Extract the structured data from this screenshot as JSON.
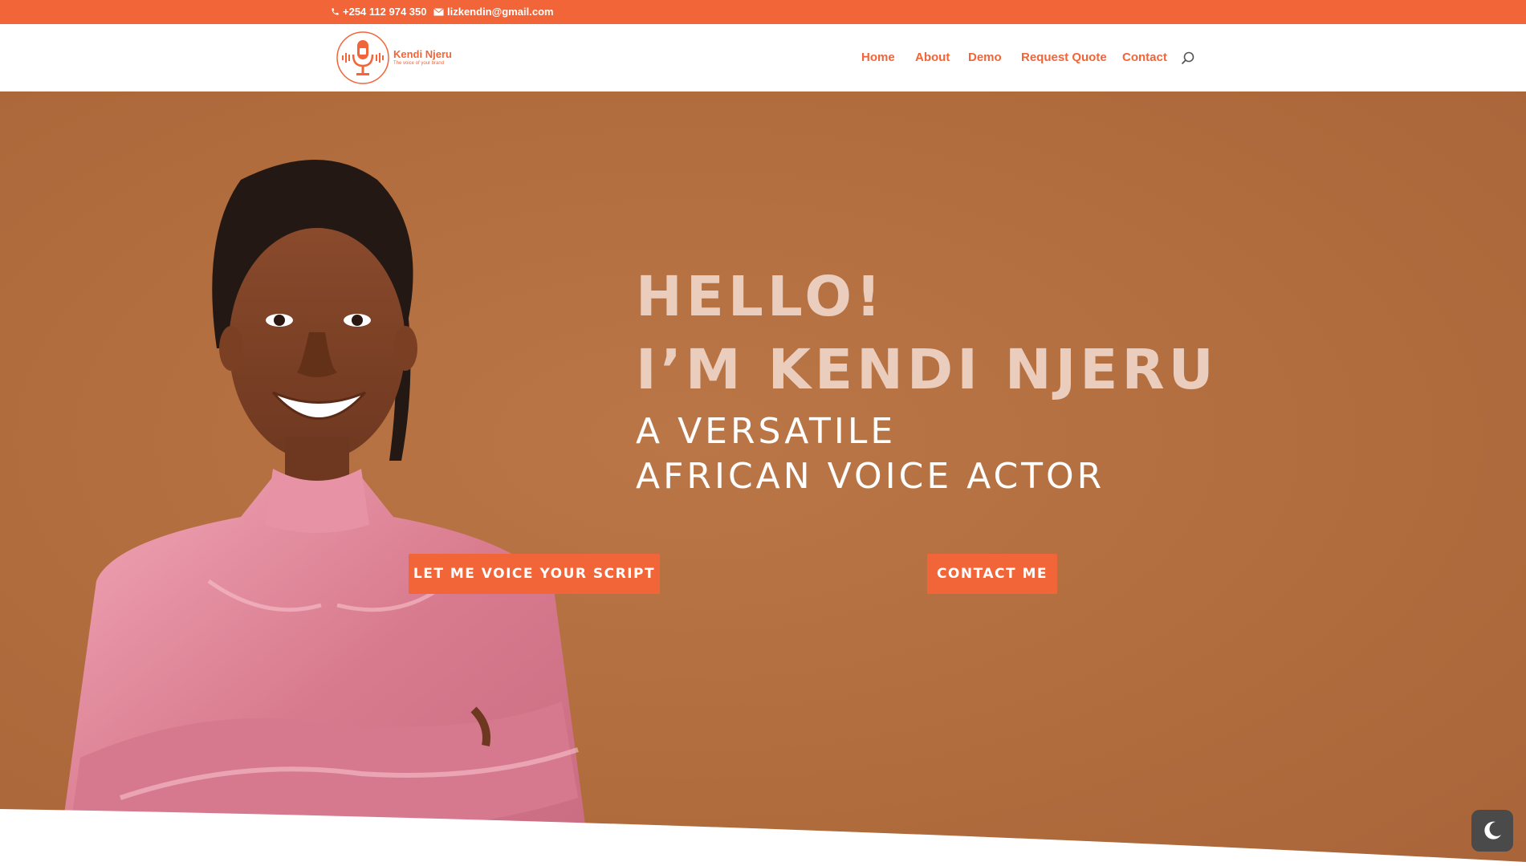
{
  "topbar": {
    "phone": "+254 112 974 350",
    "email": "lizkendin@gmail.com",
    "phone_icon": "phone-icon",
    "email_icon": "envelope-icon",
    "background": "#f26538"
  },
  "header": {
    "logo": {
      "name": "Kendi Njeru",
      "tagline": "The voice of your brand",
      "icon": "microphone-icon"
    },
    "nav": [
      {
        "label": "Home"
      },
      {
        "label": "About"
      },
      {
        "label": "Demo"
      },
      {
        "label": "Request Quote"
      },
      {
        "label": "Contact"
      }
    ],
    "search_icon": "search-icon"
  },
  "hero": {
    "greeting": "HELLO!",
    "name_line": "I’M KENDI NJERU",
    "subtitle_line1": "A VERSATILE",
    "subtitle_line2": "AFRICAN VOICE ACTOR",
    "cta_primary": "LET ME VOICE YOUR SCRIPT",
    "cta_secondary": "CONTACT ME",
    "background": "#b06c3c",
    "accent": "#f26538"
  },
  "dark_mode_toggle_icon": "moon-icon"
}
